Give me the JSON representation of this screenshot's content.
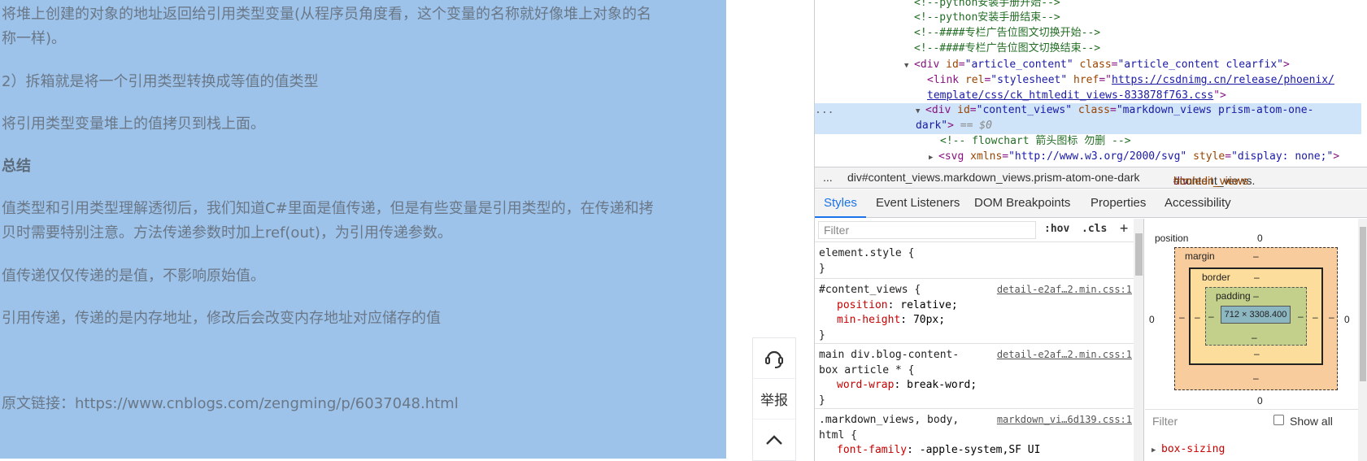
{
  "article": {
    "paragraphs": [
      "将堆上创建的对象的地址返回给引用类型变量(从程序员角度看，这个变量的名称就好像堆上对象的名",
      "称一样)。",
      "2）拆箱就是将一个引用类型转换成等值的值类型",
      "将引用类型变量堆上的值拷贝到栈上面。",
      "总结",
      "值类型和引用类型理解透彻后，我们知道C#里面是值传递，但是有些变量是引用类型的，在传递和拷",
      "贝时需要特别注意。方法传递参数时加上ref(out)，为引用传递参数。",
      "值传递仅仅传递的是值，不影响原始值。",
      "引用传递，传递的是内存地址，修改后会改变内存地址对应储存的值",
      "原文链接：https://www.cnblogs.com/zengming/p/6037048.html"
    ],
    "selection_color": "#9dc3ea"
  },
  "float_bar": {
    "support_icon": "headset-icon",
    "report_label": "举报",
    "top_icon": "chevron-up-icon"
  },
  "devtools": {
    "dom": {
      "l1": "<!--python安装手册开始-->",
      "l2": "<!--python安装手册结束-->",
      "l3": "<!--####专栏广告位图文切换开始-->",
      "l4": "<!--####专栏广告位图文切换结束-->",
      "l5_tag_open": "<div",
      "l5_attr1": "id",
      "l5_val1": "\"article_content\"",
      "l5_attr2": "class",
      "l5_val2": "\"article_content clearfix\"",
      "l6_tag": "<link",
      "l6_attr1": "rel",
      "l6_val1": "\"stylesheet\"",
      "l6_attr2": "href",
      "l6_href_a": "https://csdnimg.cn/release/phoenix/",
      "l7_href_b": "template/css/ck_htmledit_views-833878f763.css",
      "l8_tag": "<div",
      "l8_attr1": "id",
      "l8_val1": "\"content_views\"",
      "l8_attr2": "class",
      "l8_val2a": "\"markdown_views prism-atom-one-",
      "l9_val2b": "dark\"",
      "l9_eq": "== $0",
      "l10": "<!-- flowchart 箭头图标 勿删 -->",
      "l11_tag": "<svg",
      "l11_attr1": "xmlns",
      "l11_val1": "\"http://www.w3.org/2000/svg\"",
      "l11_attr2": "style",
      "l11_val2": "\"display: none;\"",
      "ellipsis": "..."
    },
    "breadcrumbs": {
      "more": "...",
      "first": "div#content_views.markdown_views.prism-atom-one-dark",
      "second_tag": "div",
      "second_rest": "#content_views.",
      "second_cls": "htmledit_views"
    },
    "tabs": [
      "Styles",
      "Event Listeners",
      "DOM Breakpoints",
      "Properties",
      "Accessibility"
    ],
    "active_tab": "Styles",
    "filter": {
      "placeholder": "Filter",
      "hov": ":hov",
      "cls": ".cls",
      "plus": "+"
    },
    "rules": {
      "r1_selector": "element.style {",
      "r1_close": "}",
      "r2_selector": "#content_views {",
      "r2_source": "detail-e2af…2.min.css:1",
      "r2_p1_name": "position",
      "r2_p1_value": "relative;",
      "r2_p2_name": "min-height",
      "r2_p2_value": "70px;",
      "r2_close": "}",
      "r3_selector_a": "main div.blog-content-",
      "r3_selector_b": "box article * {",
      "r3_source": "detail-e2af…2.min.css:1",
      "r3_p1_name": "word-wrap",
      "r3_p1_value": "break-word;",
      "r3_close": "}",
      "r4_selector_a": ".markdown_views, body,",
      "r4_selector_b": "html {",
      "r4_source": "markdown_vi…6d139.css:1",
      "r4_p1_name": "font-family",
      "r4_p1_value": "-apple-system,SF UI"
    },
    "box_model": {
      "position_label": "position",
      "position_value": "0",
      "margin_label": "margin",
      "border_label": "border",
      "padding_label": "padding",
      "dash": "–",
      "content_size": "712 × 3308.400",
      "left_zero": "0",
      "right_zero": "0",
      "bottom_zero": "0",
      "margin_color": "#f9cc9d",
      "border_color": "#fddd9b",
      "padding_color": "#c3d08b",
      "content_color": "#8cb6c0"
    },
    "computed": {
      "filter_placeholder": "Filter",
      "show_all_label": "Show all",
      "first_prop": "box-sizing"
    }
  }
}
